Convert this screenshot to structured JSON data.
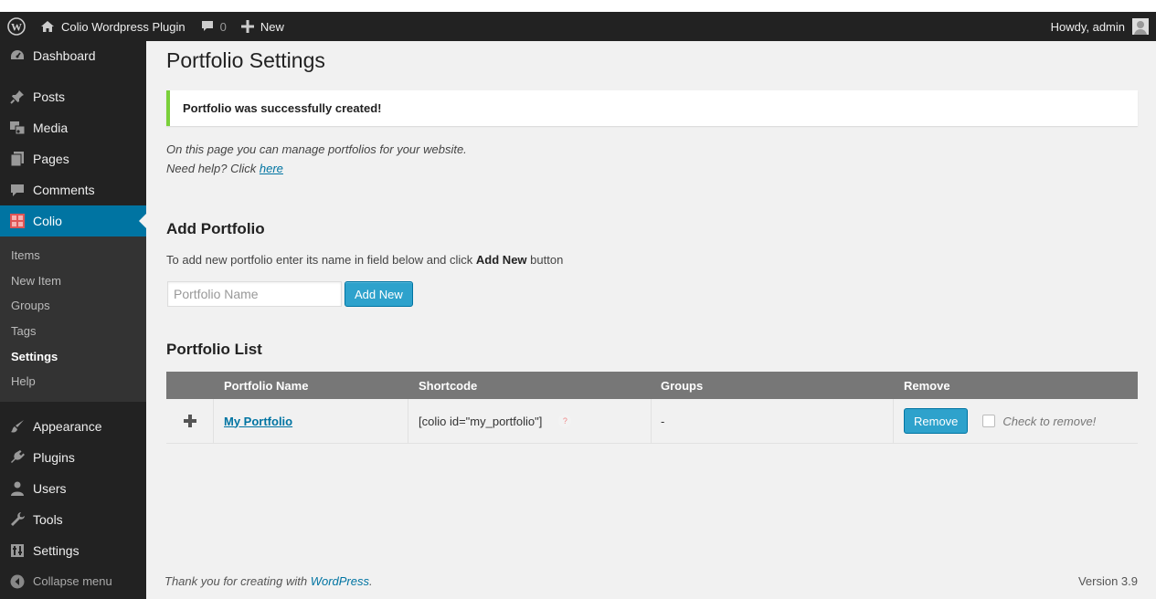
{
  "adminbar": {
    "site_name": "Colio Wordpress Plugin",
    "comments_count": "0",
    "new_label": "New",
    "howdy": "Howdy, admin"
  },
  "sidebar": {
    "items_top": [
      {
        "label": "Dashboard",
        "icon": "dashboard-icon"
      },
      {
        "label": "Posts",
        "icon": "pin-icon"
      },
      {
        "label": "Media",
        "icon": "media-icon"
      },
      {
        "label": "Pages",
        "icon": "pages-icon"
      },
      {
        "label": "Comments",
        "icon": "comment-icon"
      },
      {
        "label": "Colio",
        "icon": "colio-icon",
        "active": true
      }
    ],
    "submenu": [
      {
        "label": "Items"
      },
      {
        "label": "New Item"
      },
      {
        "label": "Groups"
      },
      {
        "label": "Tags"
      },
      {
        "label": "Settings",
        "current": true
      },
      {
        "label": "Help"
      }
    ],
    "items_bottom": [
      {
        "label": "Appearance",
        "icon": "brush-icon"
      },
      {
        "label": "Plugins",
        "icon": "plugin-icon"
      },
      {
        "label": "Users",
        "icon": "user-icon"
      },
      {
        "label": "Tools",
        "icon": "wrench-icon"
      },
      {
        "label": "Settings",
        "icon": "settings-icon"
      }
    ],
    "collapse_label": "Collapse menu"
  },
  "main": {
    "title": "Portfolio Settings",
    "notice": "Portfolio was successfully created!",
    "intro_line1": "On this page you can manage portfolios for your website.",
    "intro_line2_prefix": "Need help? Click ",
    "intro_link": "here",
    "add_heading": "Add Portfolio",
    "add_desc_prefix": "To add new portfolio enter its name in field below and click ",
    "add_desc_bold": "Add New",
    "add_desc_suffix": " button",
    "input_placeholder": "Portfolio Name",
    "add_button": "Add New",
    "list_heading": "Portfolio List",
    "table": {
      "headers": [
        "",
        "Portfolio Name",
        "Shortcode",
        "Groups",
        "Remove"
      ],
      "rows": [
        {
          "name": "My Portfolio",
          "shortcode": "[colio id=\"my_portfolio\"]",
          "groups": "-",
          "remove_label": "Remove",
          "check_label": "Check to remove!"
        }
      ]
    }
  },
  "footer": {
    "thanks_prefix": "Thank you for creating with ",
    "thanks_link": "WordPress",
    "thanks_suffix": ".",
    "version": "Version 3.9"
  }
}
